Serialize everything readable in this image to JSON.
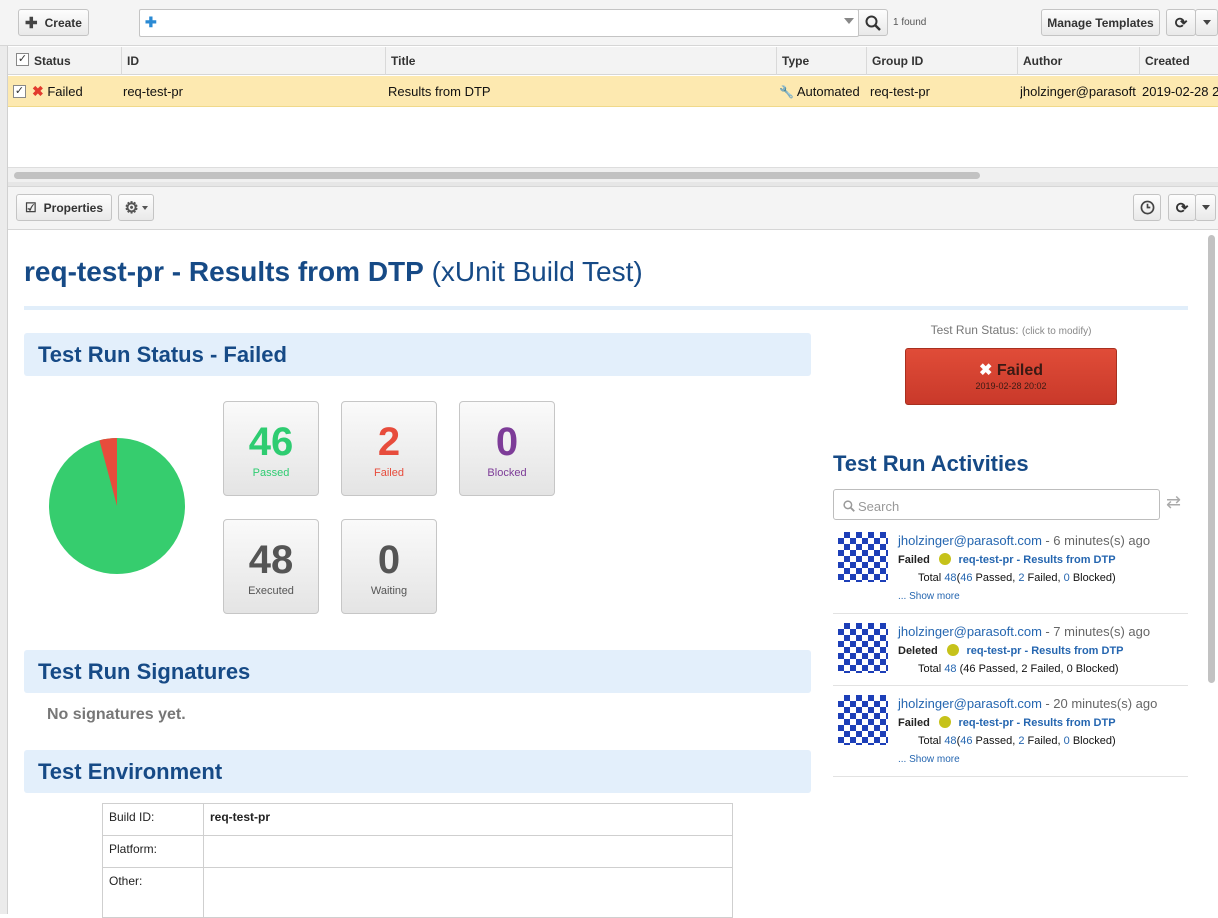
{
  "toolbar": {
    "create_label": "Create",
    "found_label": "1 found",
    "manage_templates_label": "Manage Templates"
  },
  "grid": {
    "columns": [
      "Status",
      "ID",
      "Title",
      "Type",
      "Group ID",
      "Author",
      "Created"
    ],
    "row": {
      "status": "Failed",
      "id": "req-test-pr",
      "title": "Results from DTP",
      "type": "Automated",
      "group_id": "req-test-pr",
      "author": "jholzinger@parasoft",
      "created": "2019-02-28 2"
    }
  },
  "propbar": {
    "properties_label": "Properties"
  },
  "page": {
    "title_main": "req-test-pr - Results from DTP",
    "title_sub": "(xUnit Build Test)"
  },
  "status_section": {
    "heading": "Test Run Status - Failed",
    "stats": [
      {
        "value": "46",
        "label": "Passed",
        "color": "#2ecc71"
      },
      {
        "value": "2",
        "label": "Failed",
        "color": "#e74c3c"
      },
      {
        "value": "0",
        "label": "Blocked",
        "color": "#7d3c98"
      },
      {
        "value": "48",
        "label": "Executed",
        "color": "#555555"
      },
      {
        "value": "0",
        "label": "Waiting",
        "color": "#555555"
      }
    ],
    "pie": {
      "passed": 46,
      "failed": 2,
      "passed_color": "#36cd6e",
      "failed_color": "#e74c3c"
    }
  },
  "run_status": {
    "label": "Test Run Status:",
    "hint": "(click to modify)",
    "button_label": "Failed",
    "button_date": "2019-02-28 20:02",
    "color": "#d9422f"
  },
  "signatures": {
    "heading": "Test Run Signatures",
    "empty_text": "No signatures yet."
  },
  "environment": {
    "heading": "Test Environment",
    "rows": [
      {
        "label": "Build ID:",
        "value": "req-test-pr"
      },
      {
        "label": "Platform:",
        "value": ""
      },
      {
        "label": "Other:",
        "value": ""
      }
    ]
  },
  "activities": {
    "heading": "Test Run Activities",
    "search_placeholder": "Search",
    "items": [
      {
        "user": "jholzinger@parasoft.com",
        "time": "- 6 minutes(s) ago",
        "action": "Failed",
        "link": "req-test-pr - Results from DTP",
        "total_prefix": "Total",
        "total": "48",
        "passed": "46",
        "passed_suffix": "Passed,",
        "failed": "2",
        "failed_suffix": "Failed,",
        "blocked": "0",
        "blocked_suffix": "Blocked)",
        "show_more": "... Show more"
      },
      {
        "user": "jholzinger@parasoft.com",
        "time": "- 7 minutes(s) ago",
        "action": "Deleted",
        "link": "req-test-pr - Results from DTP",
        "total_prefix": "Total",
        "total": "48",
        "rest": "(46 Passed, 2 Failed, 0 Blocked)"
      },
      {
        "user": "jholzinger@parasoft.com",
        "time": "- 20 minutes(s) ago",
        "action": "Failed",
        "link": "req-test-pr - Results from DTP",
        "total_prefix": "Total",
        "total": "48",
        "passed": "46",
        "passed_suffix": "Passed,",
        "failed": "2",
        "failed_suffix": "Failed,",
        "blocked": "0",
        "blocked_suffix": "Blocked)",
        "show_more": "... Show more"
      }
    ]
  }
}
